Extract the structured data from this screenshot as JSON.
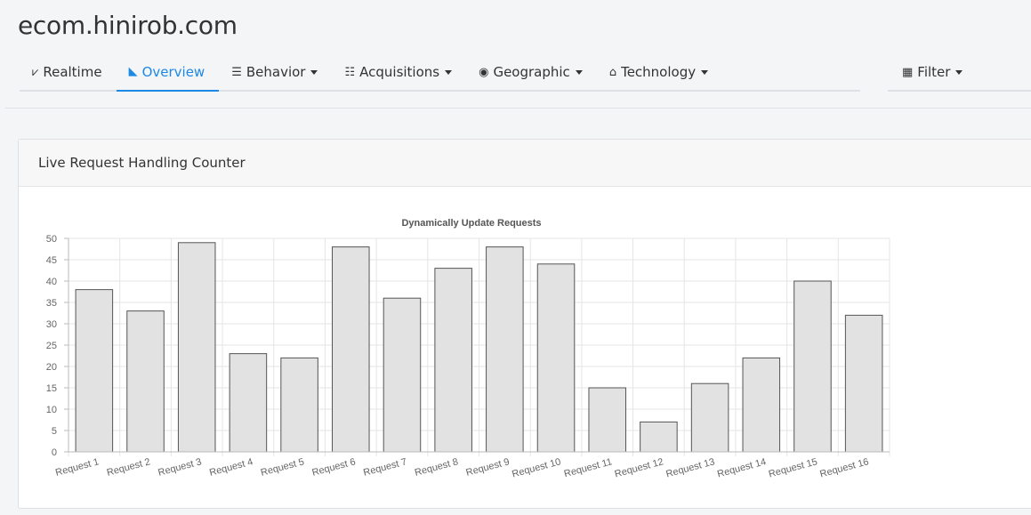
{
  "site": {
    "title": "ecom.hinirob.com"
  },
  "nav": {
    "items": [
      {
        "label": "Realtime",
        "icon": "line-chart-icon",
        "glyph": "⩗",
        "dropdown": false,
        "active": false
      },
      {
        "label": "Overview",
        "icon": "area-chart-icon",
        "glyph": "◣",
        "dropdown": false,
        "active": true
      },
      {
        "label": "Behavior",
        "icon": "table-icon",
        "glyph": "☰",
        "dropdown": true,
        "active": false
      },
      {
        "label": "Acquisitions",
        "icon": "project-diagram-icon",
        "glyph": "☷",
        "dropdown": true,
        "active": false
      },
      {
        "label": "Geographic",
        "icon": "map-marked-icon",
        "glyph": "◉",
        "dropdown": true,
        "active": false
      },
      {
        "label": "Technology",
        "icon": "laptop-house-icon",
        "glyph": "⌂",
        "dropdown": true,
        "active": false
      }
    ],
    "filter": {
      "label": "Filter",
      "icon": "calendar-icon",
      "glyph": "▦"
    }
  },
  "card": {
    "title": "Live Request Handling Counter"
  },
  "colors": {
    "accent": "#1e88e5",
    "bar_fill": "#e2e2e2",
    "bar_stroke": "#555555",
    "grid": "#e5e5e5"
  },
  "chart_data": {
    "type": "bar",
    "title": "Dynamically Update Requests",
    "xlabel": "",
    "ylabel": "",
    "categories": [
      "Request 1",
      "Request 2",
      "Request 3",
      "Request 4",
      "Request 5",
      "Request 6",
      "Request 7",
      "Request 8",
      "Request 9",
      "Request 10",
      "Request 11",
      "Request 12",
      "Request 13",
      "Request 14",
      "Request 15",
      "Request 16"
    ],
    "values": [
      38,
      33,
      49,
      23,
      22,
      48,
      36,
      43,
      48,
      44,
      15,
      7,
      16,
      22,
      40,
      32
    ],
    "ylim": [
      0,
      50
    ],
    "yticks": [
      0,
      5,
      10,
      15,
      20,
      25,
      30,
      35,
      40,
      45,
      50
    ],
    "grid": true,
    "legend": "none"
  }
}
